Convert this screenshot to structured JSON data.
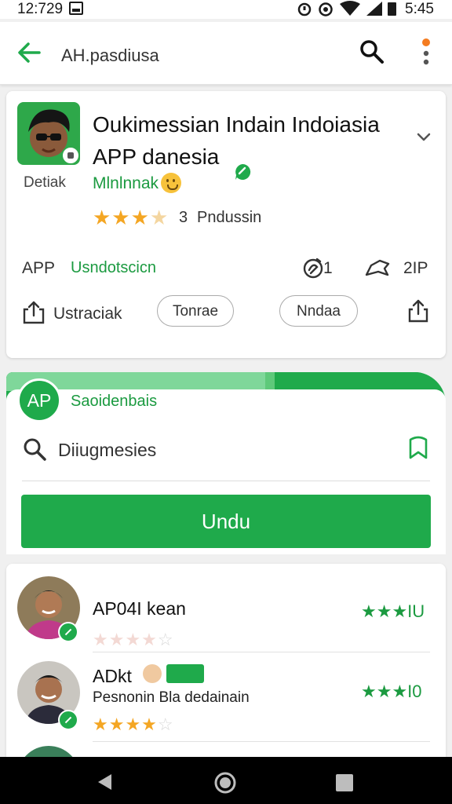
{
  "status_bar": {
    "time_left": "12:729",
    "time_right": "5:45"
  },
  "app_bar": {
    "title": "AH.pasdiusa"
  },
  "app_card": {
    "title": "Oukimessian Indain Indoiasia APP danesia",
    "developer_tag": "Detiak",
    "developer_name": "Mlnlnnak",
    "rating_count": "3",
    "rating_label": "Pndussin",
    "rating_value": 3.5,
    "info_label": "APP",
    "info_value": "Usndotscicn",
    "age_value": "1",
    "award_value": "2IP",
    "install_label": "Ustraciak",
    "chip_1": "Tonrae",
    "chip_2": "Nndaa"
  },
  "section": {
    "avatar_text": "AP",
    "title": "Saoidenbais",
    "search_text": "Diiugmesies",
    "button_label": "Undu"
  },
  "reviews": [
    {
      "name": "AP04I kean",
      "subtitle": "",
      "stars": 4,
      "score_stars": "★★★",
      "score": "IU"
    },
    {
      "name": "ADkt",
      "subtitle": "Pesnonin Bla dedainain",
      "stars": 4,
      "score_stars": "★★★",
      "score": "I0"
    }
  ],
  "colors": {
    "brand_green": "#1faa4b",
    "star_orange": "#f4a623"
  }
}
